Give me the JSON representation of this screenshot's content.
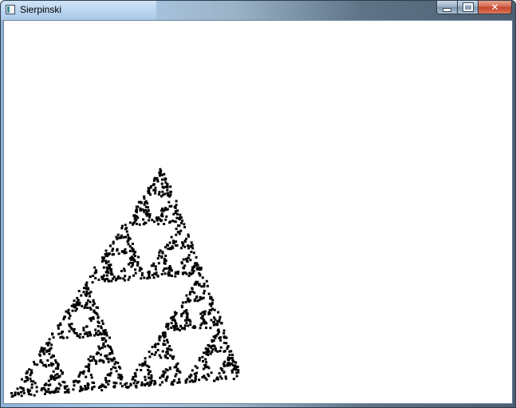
{
  "window": {
    "title": "Sierpinski",
    "background_title_text": "",
    "controls": {
      "minimize_label": "",
      "maximize_label": "",
      "close_label": "✕"
    }
  },
  "canvas": {
    "background": "#ffffff",
    "point_color": "#000000",
    "content": "sierpinski-triangle"
  }
}
